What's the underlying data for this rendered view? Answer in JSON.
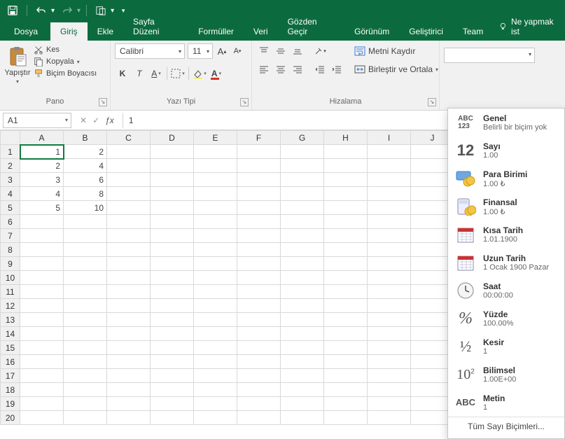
{
  "titlebar": {
    "save": "save",
    "undo": "undo",
    "redo": "redo",
    "touch": "touch"
  },
  "tabs": {
    "file": "Dosya",
    "home": "Giriş",
    "insert": "Ekle",
    "layout": "Sayfa Düzeni",
    "formulas": "Formüller",
    "data": "Veri",
    "review": "Gözden Geçir",
    "view": "Görünüm",
    "developer": "Geliştirici",
    "team": "Team",
    "tell": "Ne yapmak ist"
  },
  "ribbon": {
    "paste": "Yapıştır",
    "cut": "Kes",
    "copy": "Kopyala",
    "painter": "Biçim Boyacısı",
    "clipboard_label": "Pano",
    "font_name": "Calibri",
    "font_size": "11",
    "font_label": "Yazı Tipi",
    "wrap": "Metni Kaydır",
    "merge": "Birleştir ve Ortala",
    "align_label": "Hizalama"
  },
  "formula_bar": {
    "cell_ref": "A1",
    "formula": "1"
  },
  "columns": [
    "A",
    "B",
    "C",
    "D",
    "E",
    "F",
    "G",
    "H",
    "I",
    "J"
  ],
  "rows": [
    1,
    2,
    3,
    4,
    5,
    6,
    7,
    8,
    9,
    10,
    11,
    12,
    13,
    14,
    15,
    16,
    17,
    18,
    19,
    20
  ],
  "cells": {
    "A1": "1",
    "B1": "2",
    "A2": "2",
    "B2": "4",
    "A3": "3",
    "B3": "6",
    "A4": "4",
    "B4": "8",
    "A5": "5",
    "B5": "10"
  },
  "number_formats": [
    {
      "key": "general",
      "title": "Genel",
      "sample": "Belirli bir biçim yok",
      "icon": "abc123"
    },
    {
      "key": "number",
      "title": "Sayı",
      "sample": "1.00",
      "icon": "12"
    },
    {
      "key": "currency",
      "title": "Para Birimi",
      "sample": "1.00 ₺",
      "icon": "coins"
    },
    {
      "key": "accounting",
      "title": "Finansal",
      "sample": "1.00 ₺",
      "icon": "calc"
    },
    {
      "key": "shortdate",
      "title": "Kısa Tarih",
      "sample": "1.01.1900",
      "icon": "cal"
    },
    {
      "key": "longdate",
      "title": "Uzun Tarih",
      "sample": "1 Ocak 1900 Pazar",
      "icon": "cal"
    },
    {
      "key": "time",
      "title": "Saat",
      "sample": "00:00:00",
      "icon": "clock"
    },
    {
      "key": "percent",
      "title": "Yüzde",
      "sample": "100.00%",
      "icon": "pct"
    },
    {
      "key": "fraction",
      "title": "Kesir",
      "sample": "1",
      "icon": "frac"
    },
    {
      "key": "scientific",
      "title": "Bilimsel",
      "sample": "1.00E+00",
      "icon": "sci"
    },
    {
      "key": "text",
      "title": "Metin",
      "sample": "1",
      "icon": "abc"
    }
  ],
  "number_formats_footer": "Tüm Sayı Biçimleri..."
}
